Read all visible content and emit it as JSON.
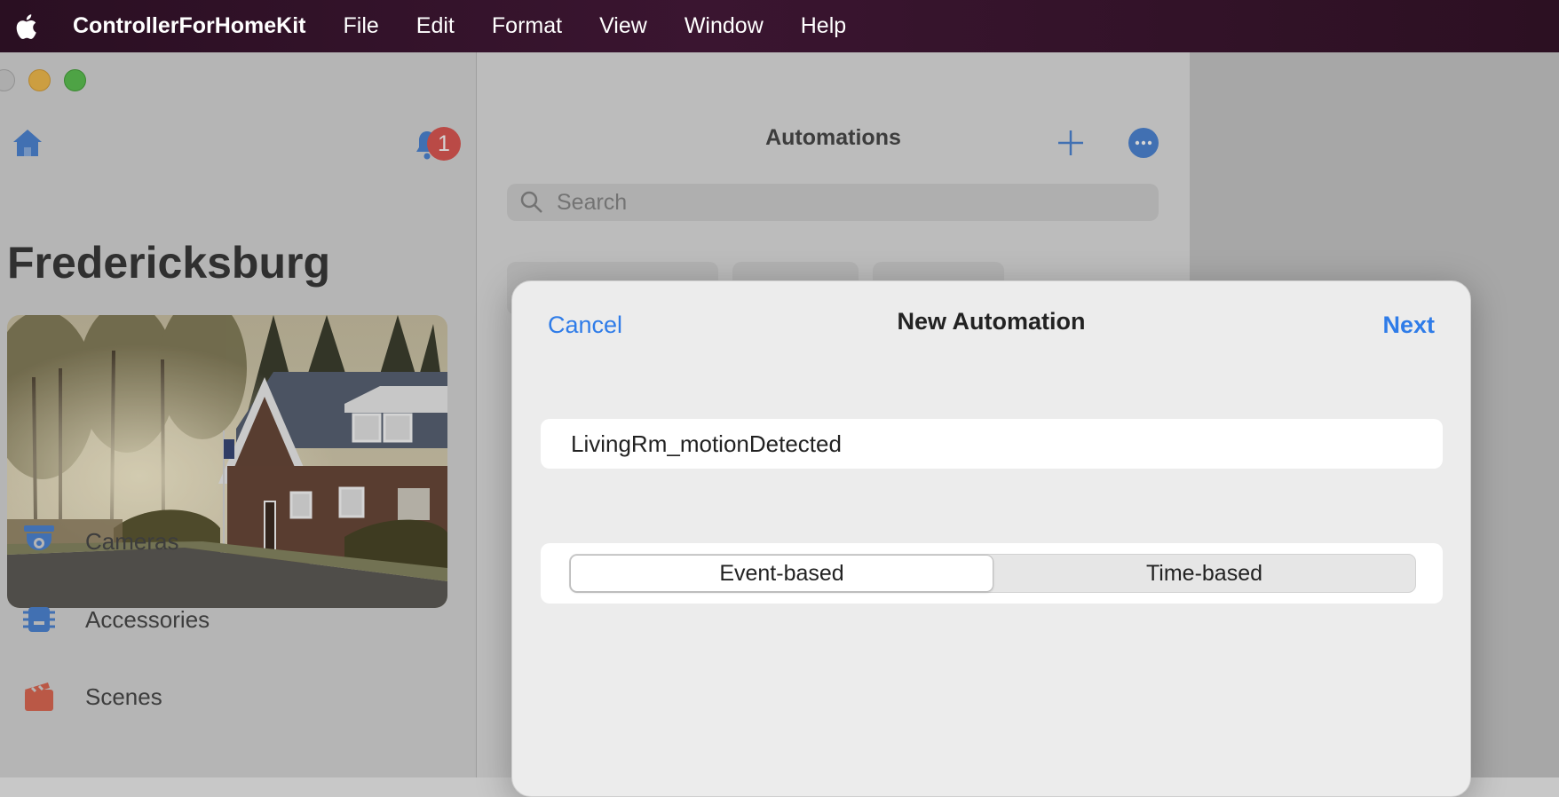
{
  "menubar": {
    "app_name": "ControllerForHomeKit",
    "items": [
      "File",
      "Edit",
      "Format",
      "View",
      "Window",
      "Help"
    ]
  },
  "sidebar": {
    "home_name": "Fredericksburg",
    "notification_count": "1",
    "nav": [
      {
        "label": "Cameras",
        "icon": "camera-icon"
      },
      {
        "label": "Accessories",
        "icon": "accessories-icon"
      },
      {
        "label": "Scenes",
        "icon": "scenes-icon"
      }
    ]
  },
  "pane": {
    "title": "Automations",
    "search_placeholder": "Search"
  },
  "sheet": {
    "title": "New Automation",
    "cancel_label": "Cancel",
    "next_label": "Next",
    "name_value": "LivingRm_motionDetected",
    "segments": [
      "Event-based",
      "Time-based"
    ],
    "selected_segment": "Event-based"
  },
  "colors": {
    "accent": "#2f7ce8",
    "badge": "#e05a55"
  }
}
